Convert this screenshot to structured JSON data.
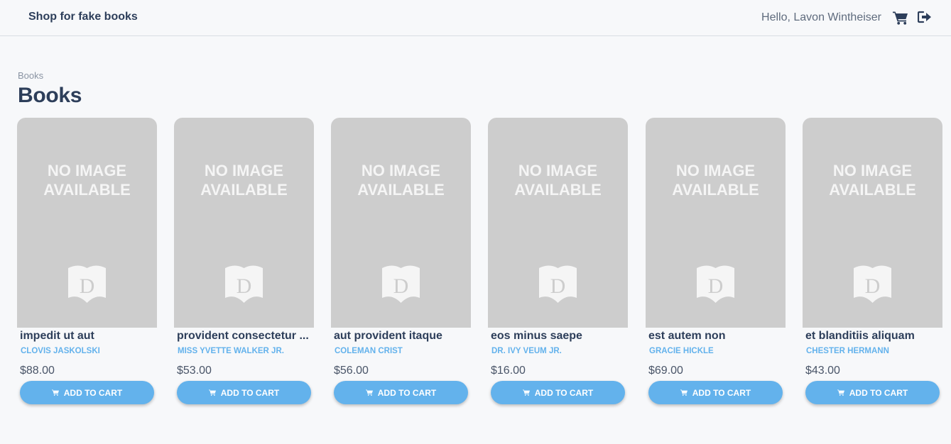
{
  "header": {
    "brand": "Shop for fake books",
    "greeting": "Hello, Lavon Wintheiser",
    "cart_icon": "cart-icon",
    "logout_icon": "sign-out-icon"
  },
  "breadcrumb": "Books",
  "page_title": "Books",
  "placeholder": {
    "line1": "NO IMAGE",
    "line2": "AVAILABLE",
    "logo_letter": "D"
  },
  "add_to_cart_label": "ADD TO CART",
  "colors": {
    "accent": "#63b2ec",
    "text": "#2d3e5a",
    "placeholder_bg": "#cdcdcd"
  },
  "books": [
    {
      "title": "impedit ut aut",
      "author": "CLOVIS JASKOLSKI",
      "price": "$88.00"
    },
    {
      "title": "provident consectetur ...",
      "author": "MISS YVETTE WALKER JR.",
      "price": "$53.00"
    },
    {
      "title": "aut provident itaque",
      "author": "COLEMAN CRIST",
      "price": "$56.00"
    },
    {
      "title": "eos minus saepe",
      "author": "DR. IVY VEUM JR.",
      "price": "$16.00"
    },
    {
      "title": "est autem non",
      "author": "GRACIE HICKLE",
      "price": "$69.00"
    },
    {
      "title": "et blanditiis aliquam",
      "author": "CHESTER HERMANN",
      "price": "$43.00"
    }
  ]
}
